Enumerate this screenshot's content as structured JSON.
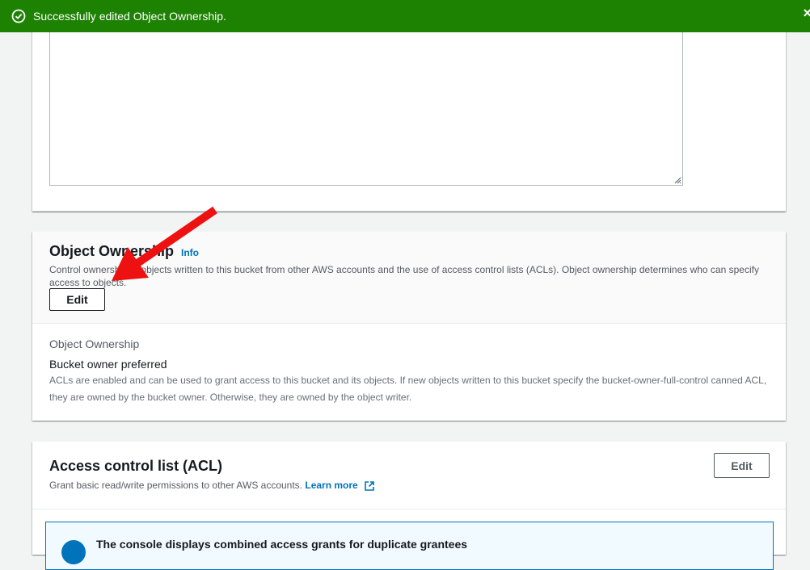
{
  "flash": {
    "message": "Successfully edited Object Ownership.",
    "close_symbol": "×",
    "color": "#1d8102"
  },
  "object_ownership_section": {
    "title": "Object Ownership",
    "info_link": "Info",
    "description": "Control ownership of objects written to this bucket from other AWS accounts and the use of access control lists (ACLs). Object ownership determines who can specify access to objects.",
    "edit_label": "Edit",
    "field_label": "Object Ownership",
    "field_value": "Bucket owner preferred",
    "field_description": "ACLs are enabled and can be used to grant access to this bucket and its objects. If new objects written to this bucket specify the bucket-owner-full-control canned ACL, they are owned by the bucket owner. Otherwise, they are owned by the object writer."
  },
  "acl_section": {
    "title": "Access control list (ACL)",
    "description": "Grant basic read/write permissions to other AWS accounts.",
    "learn_more": "Learn more",
    "edit_label": "Edit",
    "alert_text": "The console displays combined access grants for duplicate grantees"
  },
  "annotation": {
    "icon": "red-arrow",
    "color": "#ee1111"
  }
}
